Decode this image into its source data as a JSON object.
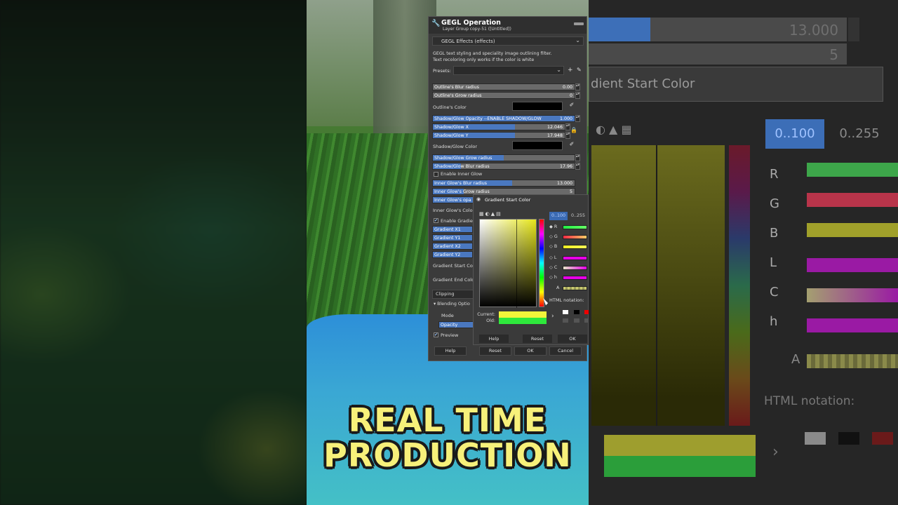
{
  "dialog": {
    "title": "GEGL Operation",
    "subtitle": "Layer Group copy-51 ([Untitled])",
    "effect_dropdown": "GEGL Effects (effects)",
    "description_line1": "GEGL text styling and speciality image outlining filter.",
    "description_line2": "Text recoloring only works if the color is white",
    "presets_label": "Presets:",
    "presets_add": "+",
    "outline_blur": {
      "label": "Outline's Blur radius",
      "value": "0.00"
    },
    "outline_grow": {
      "label": "Outline's Grow radius",
      "value": "0"
    },
    "outline_color_label": "Outline's Color",
    "shadow_opacity": {
      "label": "Shadow/Glow Opacity --ENABLE SHADOW/GLOW",
      "value": "1.000"
    },
    "shadow_x": {
      "label": "Shadow/Glow X",
      "value": "12.046"
    },
    "shadow_y": {
      "label": "Shadow/Glow Y",
      "value": "17.948"
    },
    "shadow_color_label": "Shadow/Glow Color",
    "shadow_grow": {
      "label": "Shadow/Glow Grow radius",
      "value": ""
    },
    "shadow_blur": {
      "label": "Shadow/Glow Blur radius",
      "value": "17.96"
    },
    "enable_inner_glow": "Enable Inner Glow",
    "inner_blur": {
      "label": "Inner Glow's Blur radius",
      "value": "13.000"
    },
    "inner_grow": {
      "label": "Inner Glow's Grow radius",
      "value": "5"
    },
    "inner_opacity": {
      "label": "Inner Glow's opa",
      "value": ""
    },
    "inner_color_label": "Inner Glow's Colo",
    "enable_gradient": "Enable Gradien",
    "gradient_x1": "Gradient X1",
    "gradient_y1": "Gradient Y1",
    "gradient_x2": "Gradient X2",
    "gradient_y2": "Gradient Y2",
    "gradient_start_label": "Gradient Start Colo",
    "gradient_end_label": "Gradient End Colo",
    "clipping": "Clipping",
    "blending_options": "Blending Optio",
    "mode_label": "Mode",
    "opacity_label": "Opacity",
    "preview_label": "Preview",
    "help_btn": "Help",
    "reset_btn": "Reset",
    "ok_btn": "OK",
    "cancel_btn": "Cancel"
  },
  "picker": {
    "title": "Gradient Start Color",
    "tab_0_100": "0..100",
    "tab_0_255": "0..255",
    "channels": [
      "R",
      "G",
      "B",
      "L",
      "C",
      "h",
      "A"
    ],
    "html_notation_label": "HTML notation:",
    "current_label": "Current:",
    "old_label": "Old:",
    "help_btn": "Help",
    "reset_btn": "Reset",
    "ok_btn": "OK",
    "current_color": "#f2f53a",
    "old_color": "#2ee83c"
  },
  "background_right": {
    "value_top": "13.000",
    "value_second": "5",
    "title": "dient Start Color",
    "tab_0_100": "0..100",
    "tab_0_255": "0..255",
    "channels": [
      "R",
      "G",
      "B",
      "L",
      "C",
      "h",
      "A"
    ],
    "html_notation": "HTML notation:"
  },
  "overlay": {
    "line1": "REAL TIME",
    "line2": "PRODUCTION",
    "color": "#f7f07a"
  }
}
